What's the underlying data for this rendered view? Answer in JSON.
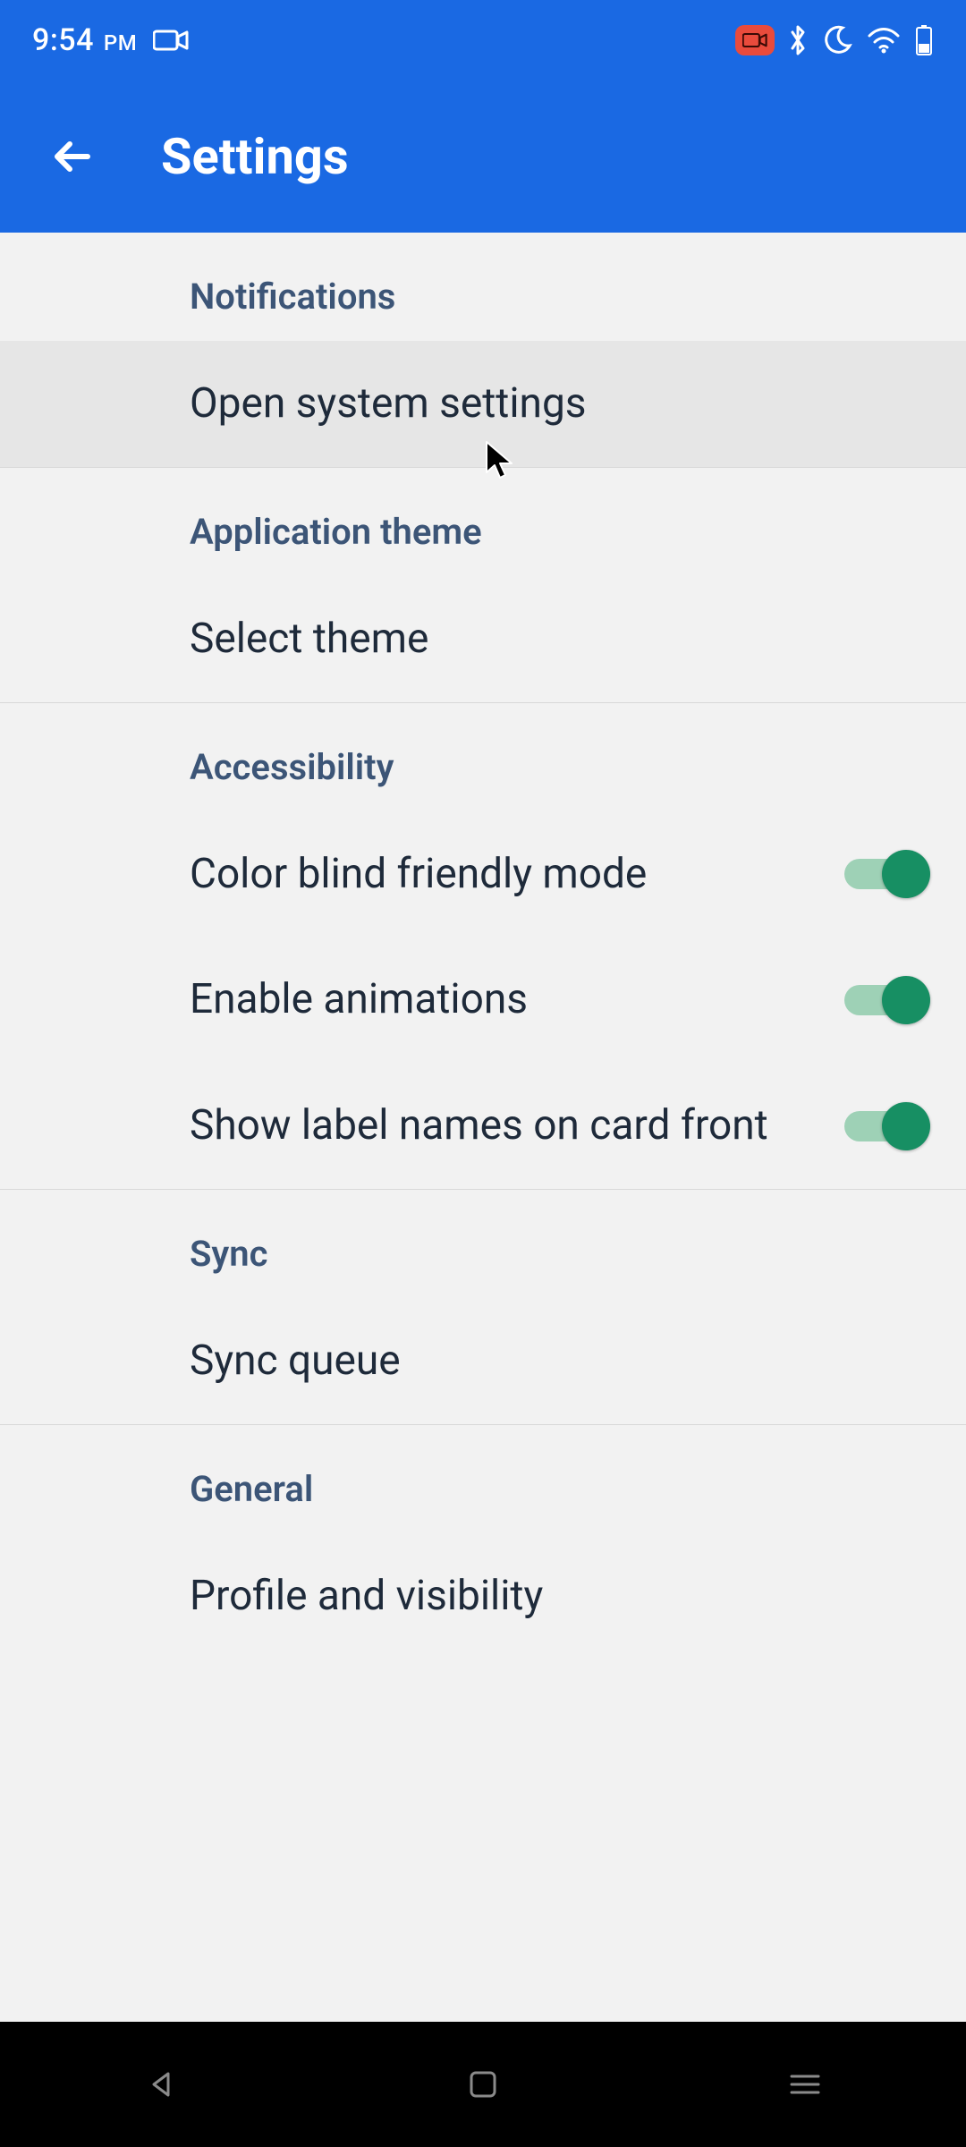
{
  "status": {
    "time": "9:54",
    "ampm": "PM"
  },
  "appbar": {
    "title": "Settings"
  },
  "sections": [
    {
      "header": "Notifications",
      "items": [
        {
          "label": "Open system settings",
          "type": "link",
          "highlight": true
        }
      ]
    },
    {
      "header": "Application theme",
      "items": [
        {
          "label": "Select theme",
          "type": "link"
        }
      ]
    },
    {
      "header": "Accessibility",
      "items": [
        {
          "label": "Color blind friendly mode",
          "type": "toggle",
          "value": true
        },
        {
          "label": "Enable animations",
          "type": "toggle",
          "value": true
        },
        {
          "label": "Show label names on card front",
          "type": "toggle",
          "value": true
        }
      ]
    },
    {
      "header": "Sync",
      "items": [
        {
          "label": "Sync queue",
          "type": "link"
        }
      ]
    },
    {
      "header": "General",
      "items": [
        {
          "label": "Profile and visibility",
          "type": "link"
        }
      ]
    }
  ]
}
